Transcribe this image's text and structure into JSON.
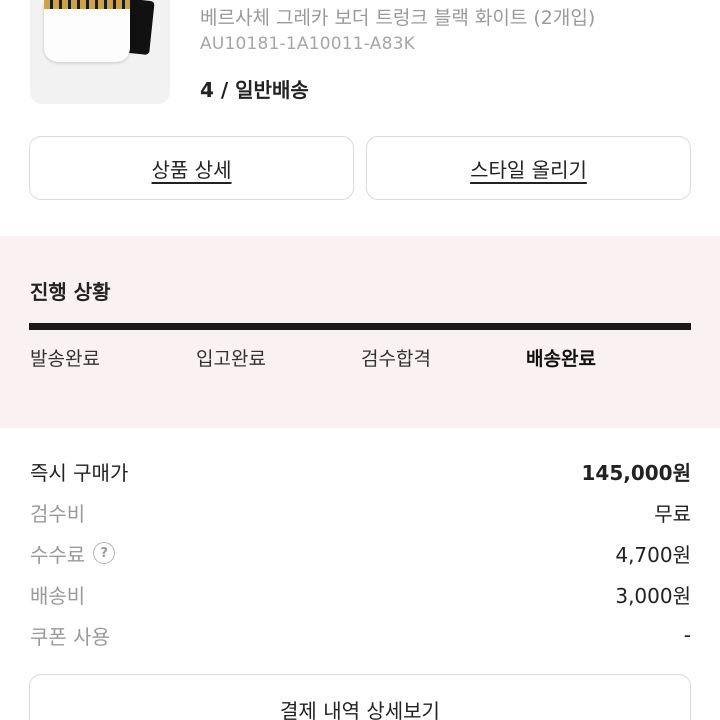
{
  "product": {
    "name": "베르사체 그레카 보더 트렁크 블랙 화이트 (2개입)",
    "code": "AU10181-1A10011-A83K",
    "option": "4 / 일반배송",
    "image_icon": "underwear-product-image"
  },
  "actions": {
    "detail_label": "상품 상세",
    "style_label": "스타일 올리기"
  },
  "progress": {
    "title": "진행 상황",
    "steps": [
      {
        "label": "발송완료"
      },
      {
        "label": "입고완료"
      },
      {
        "label": "검수합격"
      },
      {
        "label": "배송완료"
      }
    ],
    "current_step": 4,
    "bar_fill": 1.0
  },
  "prices": {
    "items": [
      {
        "label": "즉시 구매가",
        "value": "145,000원"
      },
      {
        "label": "검수비",
        "value": "무료"
      },
      {
        "label": "수수료",
        "value": "4,700원",
        "help_icon": "question-circle-icon"
      },
      {
        "label": "배송비",
        "value": "3,000원"
      },
      {
        "label": "쿠폰 사용",
        "value": "-"
      }
    ]
  },
  "payment_detail_label": "결제 내역 상세보기",
  "colors": {
    "progress_bg": "#faf2f2",
    "progress_bar": "#1a1a1a",
    "muted_text": "#9a9a9a"
  }
}
